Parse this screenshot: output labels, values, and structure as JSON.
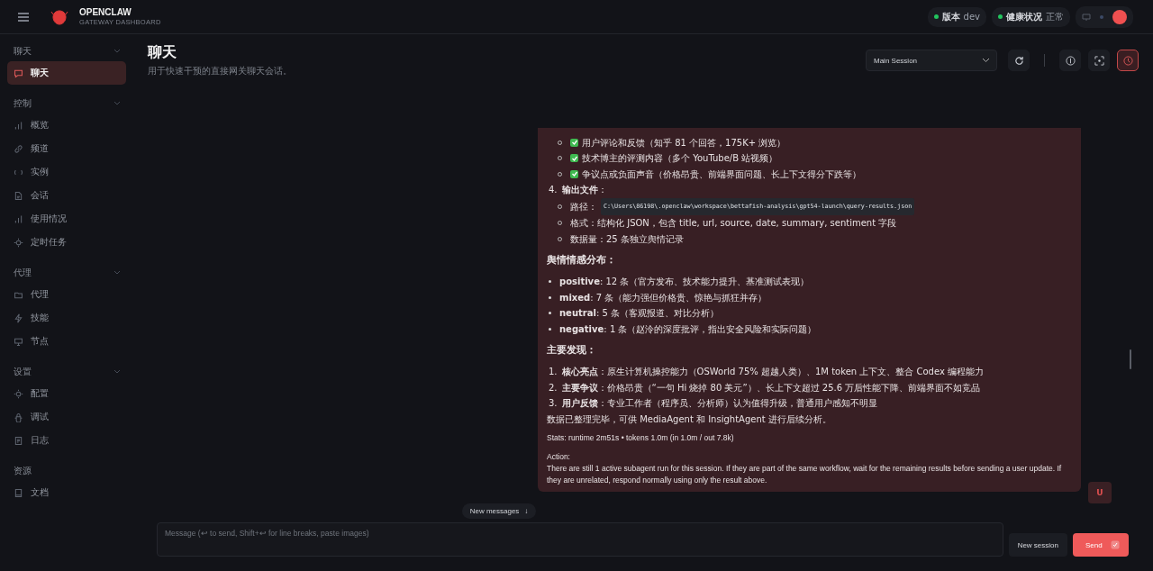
{
  "brand": {
    "name": "OPENCLAW",
    "subtitle": "GATEWAY DASHBOARD"
  },
  "status_pills": [
    {
      "label": "版本",
      "value": "dev",
      "color": "#22c55e"
    },
    {
      "label": "健康状况",
      "value": "正常",
      "color": "#22c55e"
    }
  ],
  "sidebar": {
    "groups": [
      {
        "label": "聊天",
        "collapsible": true,
        "items": [
          {
            "label": "聊天",
            "selected": true
          }
        ]
      },
      {
        "label": "控制",
        "collapsible": true,
        "items": [
          {
            "label": "概览",
            "selected": false
          },
          {
            "label": "频道",
            "selected": false
          },
          {
            "label": "实例",
            "selected": false
          },
          {
            "label": "会话",
            "selected": false
          },
          {
            "label": "使用情况",
            "selected": false
          },
          {
            "label": "定时任务",
            "selected": false
          }
        ]
      },
      {
        "label": "代理",
        "collapsible": true,
        "items": [
          {
            "label": "代理",
            "selected": false
          },
          {
            "label": "技能",
            "selected": false
          },
          {
            "label": "节点",
            "selected": false
          }
        ]
      },
      {
        "label": "设置",
        "collapsible": true,
        "items": [
          {
            "label": "配置",
            "selected": false
          },
          {
            "label": "调试",
            "selected": false
          },
          {
            "label": "日志",
            "selected": false
          }
        ]
      },
      {
        "label": "资源",
        "collapsible": false,
        "items": [
          {
            "label": "文档",
            "selected": false
          }
        ]
      }
    ]
  },
  "page": {
    "title": "聊天",
    "subtitle": "用于快速干预的直接网关聊天会话。"
  },
  "toolbar": {
    "session_select": "Main Session",
    "tool_buttons": [
      {
        "selected": false
      },
      {
        "selected": false
      },
      {
        "selected": true
      }
    ]
  },
  "message": {
    "blocks": [
      {
        "kind": "check",
        "text": "用户评论和反馈（知乎 81 个回答，175K+ 浏览）",
        "checked": true
      },
      {
        "kind": "check",
        "text": "技术博主的评测内容（多个 YouTube/B 站视频）",
        "checked": true
      },
      {
        "kind": "check",
        "text": "争议点或负面声音（价格昂贵、前端界面问题、长上下文得分下跌等）",
        "checked": true
      },
      {
        "kind": "ol",
        "number": "4.",
        "text": "**输出文件**："
      },
      {
        "kind": "sub-code",
        "text": "路径：",
        "code": "C:\\Users\\86198\\.openclaw\\workspace\\bettafish-analysis\\gpt54-launch\\query-results.json"
      },
      {
        "kind": "sub",
        "text": "格式：结构化 JSON，包含 title, url, source, date, summary, sentiment 字段"
      },
      {
        "kind": "sub",
        "text": "数据量：25 条独立舆情记录"
      },
      {
        "kind": "heading",
        "text": "舆情情感分布："
      },
      {
        "kind": "bullet",
        "text": "**positive**: 12 条（官方发布、技术能力提升、基准测试表现）"
      },
      {
        "kind": "bullet",
        "text": "**mixed**: 7 条（能力强但价格贵、惊艳与抓狂并存）"
      },
      {
        "kind": "bullet",
        "text": "**neutral**: 5 条（客观报道、对比分析）"
      },
      {
        "kind": "bullet",
        "text": "**negative**: 1 条（赵泠的深度批评，指出安全风险和实际问题）"
      },
      {
        "kind": "heading",
        "text": "主要发现："
      },
      {
        "kind": "ol",
        "number": "1.",
        "text": "**核心亮点**：原生计算机操控能力（OSWorld 75% 超越人类）、1M token 上下文、整合 Codex 编程能力"
      },
      {
        "kind": "ol",
        "number": "2.",
        "text": "**主要争议**：价格昂贵（“一句 Hi 烧掉 80 美元”）、长上下文超过 25.6 万后性能下降、前端界面不如竞品"
      },
      {
        "kind": "ol",
        "number": "3.",
        "text": "**用户反馈**：专业工作者（程序员、分析师）认为值得升级，普通用户感知不明显"
      },
      {
        "kind": "para",
        "text": "数据已整理完毕，可供 MediaAgent 和 InsightAgent 进行后续分析。"
      },
      {
        "kind": "small",
        "text": "Stats: runtime 2m51s • tokens 1.0m (in 1.0m / out 7.8k)"
      },
      {
        "kind": "small-tight",
        "text": "Action:"
      },
      {
        "kind": "small",
        "text": "There are still 1 active subagent run for this session. If they are part of the same workflow, wait for the remaining results before sending a user update. If they are unrelated, respond normally using only the result above."
      }
    ]
  },
  "user_avatar": "U",
  "new_messages": "New messages",
  "new_messages_arrow": "↓",
  "composer": {
    "placeholder": "Message (↩ to send, Shift+↩ for line breaks, paste images)",
    "new_session": "New session",
    "send": "Send"
  }
}
